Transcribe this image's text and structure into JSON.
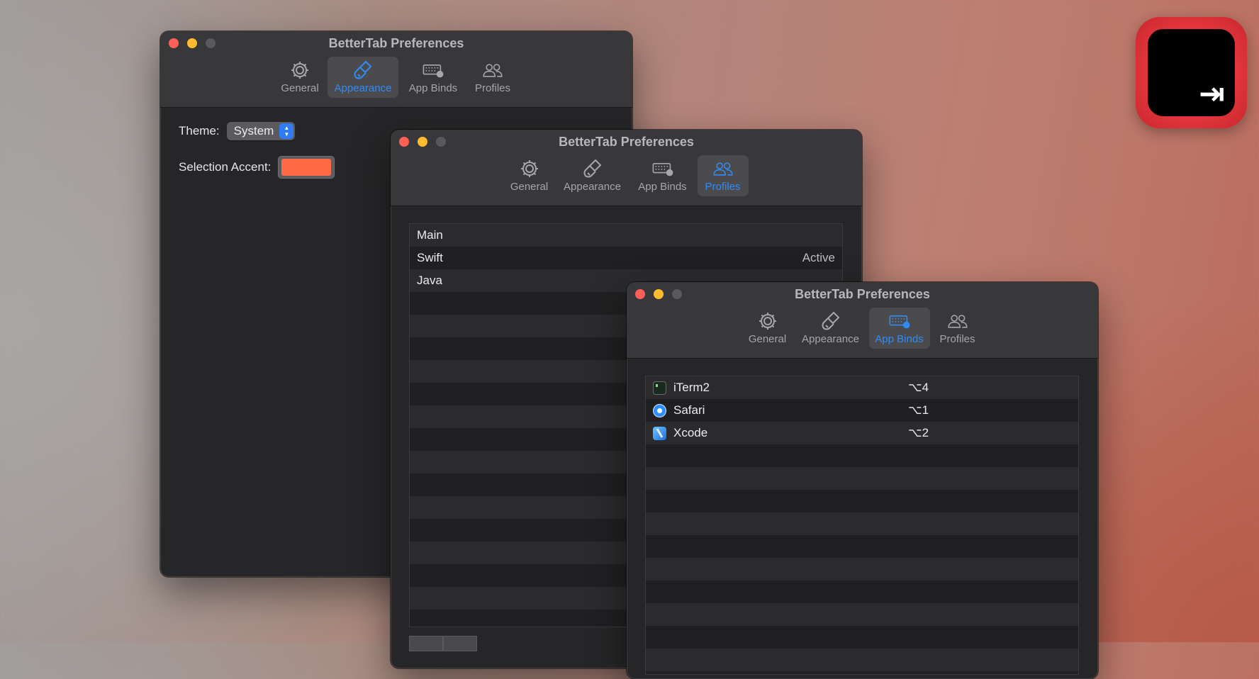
{
  "windows": [
    {
      "title": "BetterTab Preferences",
      "selected_tab": "Appearance",
      "tabs": [
        {
          "label": "General",
          "icon": "gear-icon"
        },
        {
          "label": "Appearance",
          "icon": "paintbrush-icon"
        },
        {
          "label": "App Binds",
          "icon": "keyboard-icon"
        },
        {
          "label": "Profiles",
          "icon": "people-icon"
        }
      ],
      "theme_label": "Theme:",
      "theme_value": "System",
      "accent_label": "Selection Accent:",
      "accent_color": "#ff6a45"
    },
    {
      "title": "BetterTab Preferences",
      "selected_tab": "Profiles",
      "tabs": [
        {
          "label": "General",
          "icon": "gear-icon"
        },
        {
          "label": "Appearance",
          "icon": "paintbrush-icon"
        },
        {
          "label": "App Binds",
          "icon": "keyboard-icon"
        },
        {
          "label": "Profiles",
          "icon": "people-icon"
        }
      ],
      "profiles": [
        {
          "name": "Main",
          "status": ""
        },
        {
          "name": "Swift",
          "status": "Active"
        },
        {
          "name": "Java",
          "status": ""
        }
      ]
    },
    {
      "title": "BetterTab Preferences",
      "selected_tab": "App Binds",
      "tabs": [
        {
          "label": "General",
          "icon": "gear-icon"
        },
        {
          "label": "Appearance",
          "icon": "paintbrush-icon"
        },
        {
          "label": "App Binds",
          "icon": "keyboard-icon"
        },
        {
          "label": "Profiles",
          "icon": "people-icon"
        }
      ],
      "binds": [
        {
          "app": "iTerm2",
          "shortcut": "⌥4",
          "icon": "iterm-icon"
        },
        {
          "app": "Safari",
          "shortcut": "⌥1",
          "icon": "safari-icon"
        },
        {
          "app": "Xcode",
          "shortcut": "⌥2",
          "icon": "xcode-icon"
        }
      ]
    }
  ],
  "app_logo": {
    "icon": "bettertab-logo-icon",
    "glyph": "⇥"
  },
  "colors": {
    "selected_tab": "#2f8cf7",
    "window_bg": "#262628",
    "titlebar": "#38383a"
  }
}
